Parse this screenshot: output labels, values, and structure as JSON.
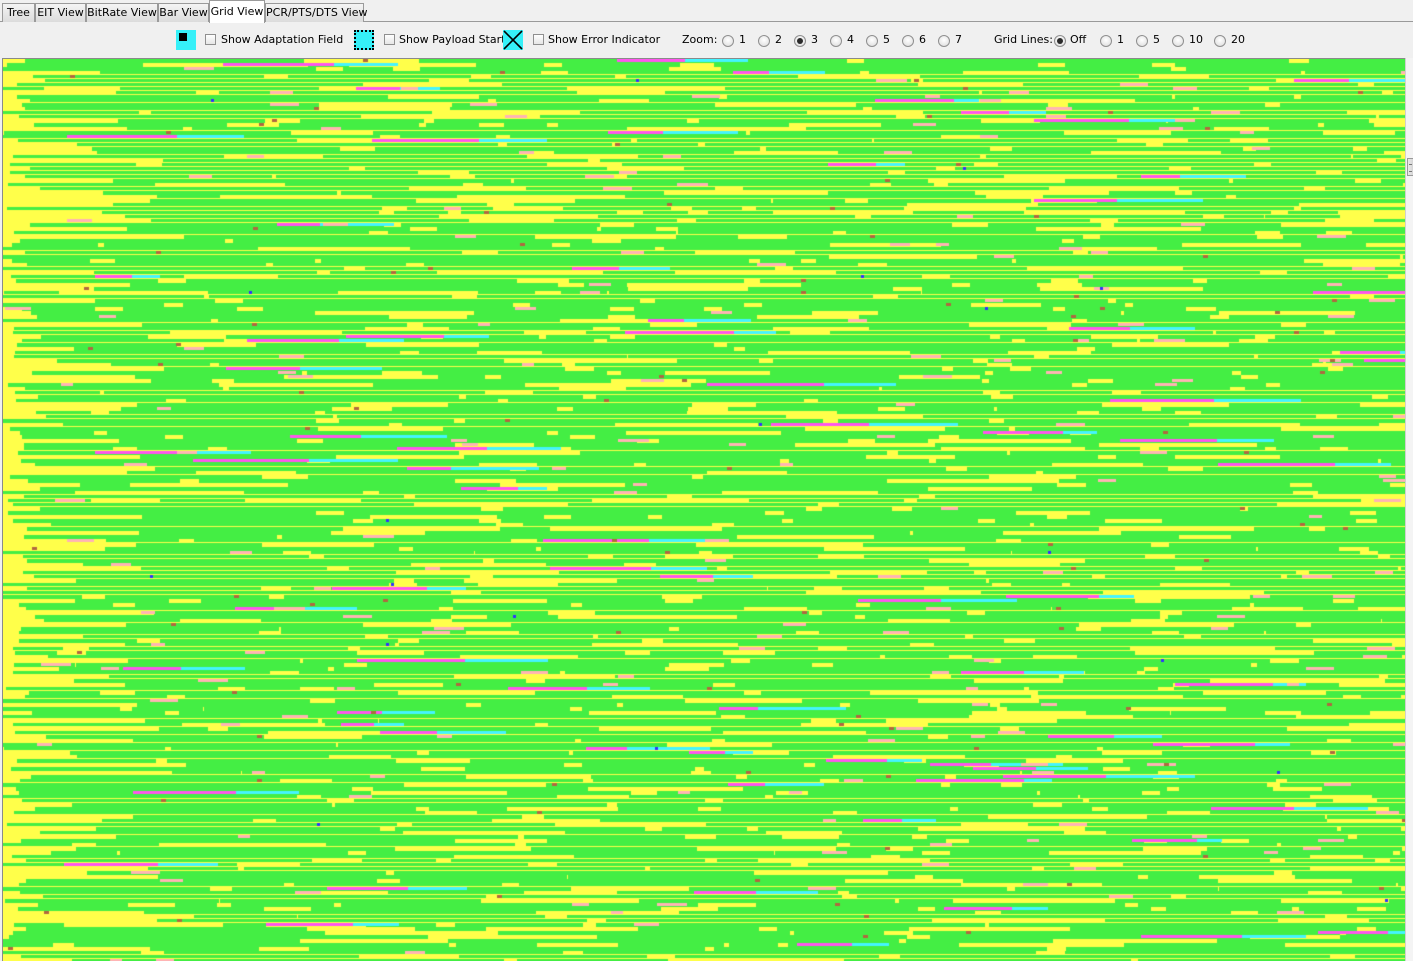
{
  "tabs": [
    {
      "label": "Tree",
      "active": false
    },
    {
      "label": "EIT View",
      "active": false
    },
    {
      "label": "BitRate View",
      "active": false
    },
    {
      "label": "Bar View",
      "active": false
    },
    {
      "label": "Grid View",
      "active": true
    },
    {
      "label": "PCR/PTS/DTS View",
      "active": false
    }
  ],
  "options": {
    "show_adaptation_field": {
      "label": "Show Adaptation Field",
      "checked": false,
      "icon": "adaptation-field-symbol-icon"
    },
    "show_payload_start": {
      "label": "Show Payload Start",
      "checked": false,
      "icon": "payload-start-symbol-icon"
    },
    "show_error_indicator": {
      "label": "Show Error Indicator",
      "checked": false,
      "icon": "error-indicator-symbol-icon"
    }
  },
  "zoom": {
    "label": "Zoom:",
    "options": [
      "1",
      "2",
      "3",
      "4",
      "5",
      "6",
      "7"
    ],
    "selected": "3"
  },
  "grid_lines": {
    "label": "Grid Lines:",
    "options": [
      "Off",
      "1",
      "5",
      "10",
      "20"
    ],
    "selected": "Off"
  },
  "colors": {
    "background": "#ffff4a",
    "green": "#44ee44",
    "magenta": "#ff55ee",
    "cyan": "#44f4ff",
    "pink": "#ffb4b4",
    "brown": "#b06840",
    "blue": "#3030ff"
  }
}
